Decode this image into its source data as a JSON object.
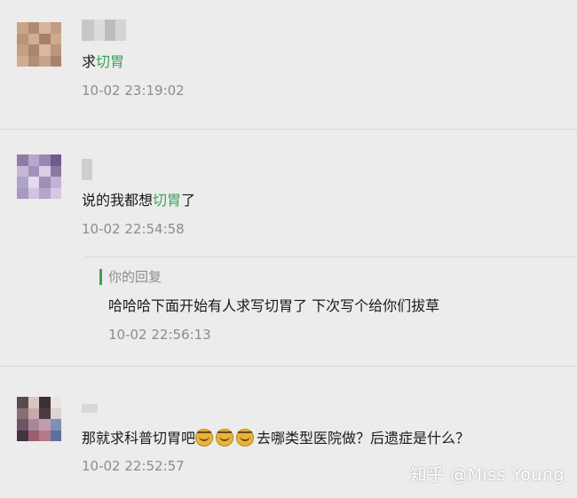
{
  "colors": {
    "highlight": "#3aa35a",
    "time": "#8c8c8c",
    "background": "#ececec"
  },
  "comments": [
    {
      "text_before": "求",
      "text_highlight": "切胃",
      "text_after": "",
      "time": "10-02 23:19:02"
    },
    {
      "text_before": "说的我都想",
      "text_highlight": "切胃",
      "text_after": "了",
      "time": "10-02 22:54:58",
      "reply": {
        "label": "你的回复",
        "text": "哈哈哈下面开始有人求写切胃了 下次写个给你们拔草",
        "time": "10-02 22:56:13"
      }
    },
    {
      "text_before": "那就求科普",
      "text_highlight": "",
      "text_mid": "切胃吧",
      "emoji_icon": "laughing-face-icon",
      "text_after": "去哪类型医院做？后遗症是什么？",
      "time": "10-02 22:52:57"
    }
  ],
  "watermark": "知乎 @Miss Young"
}
